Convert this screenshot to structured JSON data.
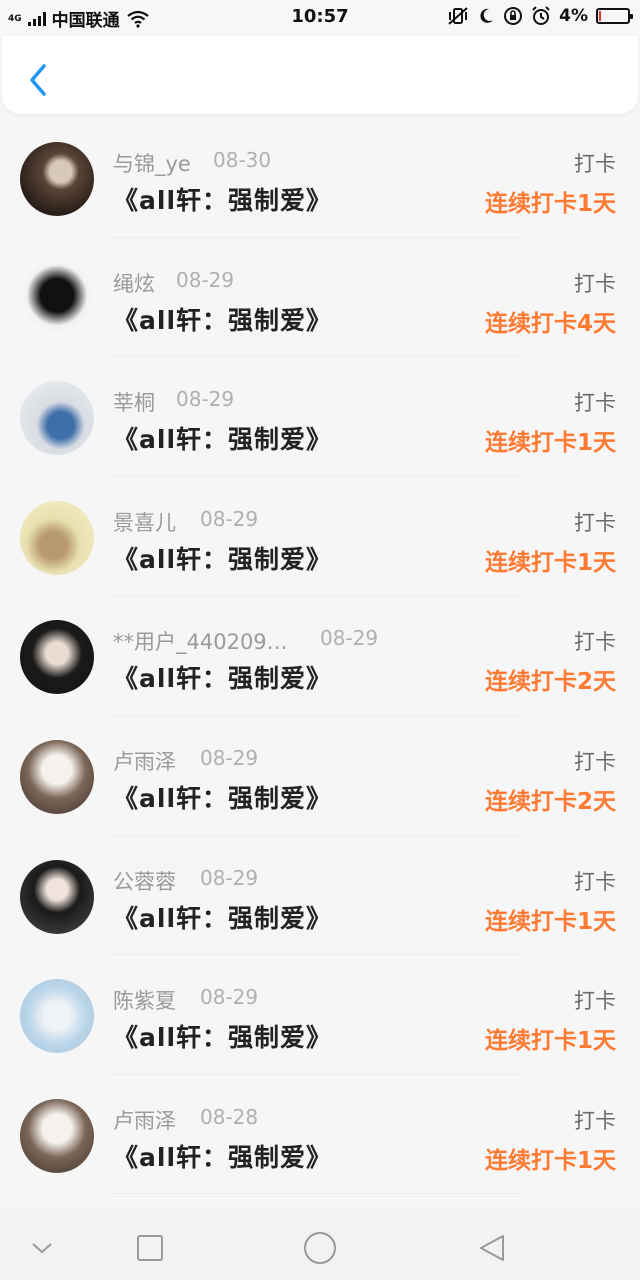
{
  "status_bar": {
    "network": "4G",
    "carrier": "中国联通",
    "time": "10:57",
    "battery_text": "4%",
    "battery_level": 0.04
  },
  "header": {
    "back_icon": "chevron-left-icon"
  },
  "entries": [
    {
      "name": "与锦_ye",
      "date": "08-30",
      "title": "《all轩：强制爱》",
      "action": "打卡",
      "streak": "连续打卡1天"
    },
    {
      "name": "绳炫",
      "date": "08-29",
      "title": "《all轩：强制爱》",
      "action": "打卡",
      "streak": "连续打卡4天"
    },
    {
      "name": "莘桐",
      "date": "08-29",
      "title": "《all轩：强制爱》",
      "action": "打卡",
      "streak": "连续打卡1天"
    },
    {
      "name": "景喜儿",
      "date": "08-29",
      "title": "《all轩：强制爱》",
      "action": "打卡",
      "streak": "连续打卡1天"
    },
    {
      "name": "**用户_440209…",
      "date": "08-29",
      "title": "《all轩：强制爱》",
      "action": "打卡",
      "streak": "连续打卡2天"
    },
    {
      "name": "卢雨泽",
      "date": "08-29",
      "title": "《all轩：强制爱》",
      "action": "打卡",
      "streak": "连续打卡2天"
    },
    {
      "name": "公蓉蓉",
      "date": "08-29",
      "title": "《all轩：强制爱》",
      "action": "打卡",
      "streak": "连续打卡1天"
    },
    {
      "name": "陈紫夏",
      "date": "08-29",
      "title": "《all轩：强制爱》",
      "action": "打卡",
      "streak": "连续打卡1天"
    },
    {
      "name": "卢雨泽",
      "date": "08-28",
      "title": "《all轩：强制爱》",
      "action": "打卡",
      "streak": "连续打卡1天"
    }
  ],
  "colors": {
    "accent_blue": "#2196f3",
    "streak_orange": "#ff7a33",
    "name_gray": "#9a9a9a"
  },
  "nav_icons": [
    "chevron-down-icon",
    "square-icon",
    "circle-icon",
    "triangle-back-icon"
  ]
}
